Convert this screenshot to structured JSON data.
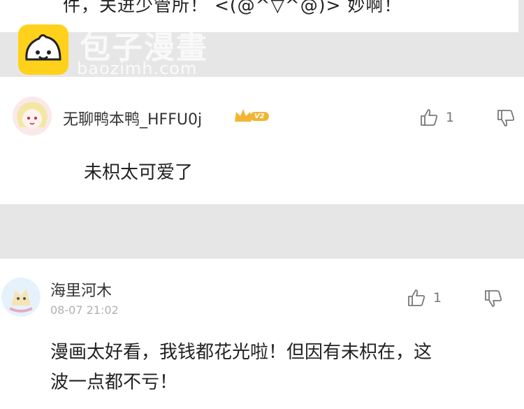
{
  "watermark": {
    "title": "包子漫畫",
    "url": "baozimh.com",
    "logo_icon": "bun-face-icon",
    "logo_color": "#ffd11a"
  },
  "top_comment": {
    "text_fragment": "件，关进少管所！ <(@^▽^@)> 妙啊！"
  },
  "comments": [
    {
      "username": "无聊鸭本鸭_HFFU0j",
      "level_badge": "V2",
      "crown_icon": "crown-icon",
      "likes": "1",
      "text": "未枳太可爱了"
    },
    {
      "username": "海里河木",
      "timestamp": "08-07 21:02",
      "likes": "1",
      "text_line1": "漫画太好看，我钱都花光啦！但因有未枳在，这",
      "text_line2": "波一点都不亏！"
    }
  ],
  "colors": {
    "accent_gold": "#f2b532",
    "band_gray": "#e6e6e6"
  }
}
